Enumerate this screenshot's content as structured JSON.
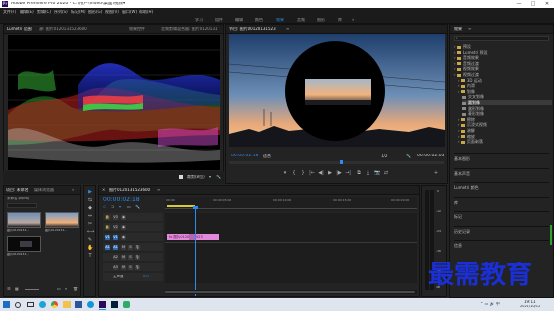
{
  "titlebar": {
    "app_logo": "Pr",
    "title": "Adobe Premiere Pro 2020 - C:\\用户\\Video\\桌面\\视频▾",
    "minimize": "—",
    "maximize": "□",
    "close": "✕"
  },
  "menu": [
    "文件(F)",
    "编辑(E)",
    "剪辑(C)",
    "序列(S)",
    "标记(M)",
    "图形(G)",
    "视图(V)",
    "窗口(W)",
    "帮助(H)"
  ],
  "workspaces": [
    "学习",
    "组件",
    "编辑",
    "颜色",
    "效果",
    "音频",
    "图形",
    "库",
    "»"
  ],
  "active_workspace": "效果",
  "scopes": {
    "tabs": [
      "Lumetri 范围",
      "源: 图片0120131523600",
      "效果控件",
      "音频剪辑混合器: 图片0120131"
    ],
    "active_tab": "Lumetri 范围",
    "footer_mode": "裁剪(8位)",
    "footer_mode_arrow": "▾",
    "menu_icon": "≡",
    "wrench_icon": "🔧"
  },
  "program": {
    "tab": "节目: 图片00120131523",
    "menu_icon": "≡",
    "timecode_left": "00:00:02:18",
    "fit": "适合",
    "quality": "1/2",
    "timecode_right": "00:00:02:03"
  },
  "transport": [
    "▾",
    "{",
    "}",
    "|←",
    "◀|",
    "▶",
    "|▶",
    "→|",
    "⧉",
    "⤓",
    "📷",
    "⇄",
    "+"
  ],
  "project": {
    "tabs": [
      "项目: 未命名",
      "媒体浏览器"
    ],
    "menu_icon": "≡",
    "expand": "»",
    "bin_name": "未命名.prproj",
    "search_placeholder": "",
    "items": [
      {
        "name": "图片0120131...",
        "kind": "image"
      },
      {
        "name": "图片0120131...",
        "kind": "sunset"
      },
      {
        "name": "图片0120131...",
        "kind": "dark"
      }
    ],
    "footer_count": "1 项"
  },
  "tools": [
    "▶",
    "⇆",
    "◆",
    "⇔",
    "✂",
    "⟷",
    "✎",
    "✋",
    "T"
  ],
  "timeline": {
    "tab": "图片0120131523600",
    "menu_icon": "≡",
    "timecode": "00:00:02:18",
    "ruler": [
      "00:00",
      "00:00:05:00",
      "00:00:10:00",
      "00:00:15:00",
      "00:00:20:00"
    ],
    "tracks": [
      {
        "name": "V3",
        "clip": ""
      },
      {
        "name": "V2",
        "clip": ""
      },
      {
        "name": "V1",
        "clip": "fx 图片0120131523"
      },
      {
        "name": "A1",
        "clip": ""
      },
      {
        "name": "A2",
        "clip": ""
      },
      {
        "name": "A3",
        "clip": ""
      }
    ],
    "master": "主声道",
    "master_value": "0.0"
  },
  "audio_meters": [
    "0",
    "-12",
    "-24",
    "-36",
    "-48",
    "dB"
  ],
  "effects": {
    "tab": "效果",
    "menu_icon": "≡",
    "search_placeholder": "",
    "tree": [
      {
        "label": "预设",
        "indent": 0
      },
      {
        "label": "Lumetri 预设",
        "indent": 0
      },
      {
        "label": "音频效果",
        "indent": 0
      },
      {
        "label": "音频过渡",
        "indent": 0
      },
      {
        "label": "视频效果",
        "indent": 0
      },
      {
        "label": "视频过渡",
        "indent": 0
      },
      {
        "label": "3D 运动",
        "indent": 1
      },
      {
        "label": "内滑",
        "indent": 1
      },
      {
        "label": "划像",
        "indent": 1
      },
      {
        "label": "交叉划像",
        "indent": 2
      },
      {
        "label": "圆划像",
        "indent": 2,
        "selected": true
      },
      {
        "label": "盒形划像",
        "indent": 2
      },
      {
        "label": "菱形划像",
        "indent": 2
      },
      {
        "label": "擦除",
        "indent": 1
      },
      {
        "label": "沉浸式视频",
        "indent": 1
      },
      {
        "label": "溶解",
        "indent": 1
      },
      {
        "label": "缩放",
        "indent": 1
      },
      {
        "label": "页面剥落",
        "indent": 1
      }
    ],
    "panels_below": [
      "基本图形",
      "基本声音",
      "Lumetri 颜色",
      "库",
      "标记",
      "历史记录",
      "信息"
    ]
  },
  "taskbar": {
    "icons": [
      "windows-start",
      "search",
      "task-view",
      "edge",
      "chrome",
      "folder",
      "word",
      "qq",
      "premiere",
      "photoshop",
      "wechat",
      "ae",
      "folder2"
    ],
    "tray": "⌃ ▭ 🔊 中",
    "time": "19:11",
    "date": "2021/10/12"
  },
  "watermark": "最需教育",
  "colors": {
    "accent": "#2d8ceb",
    "clip": "#e28ad9",
    "playhead": "#2d8ceb"
  }
}
